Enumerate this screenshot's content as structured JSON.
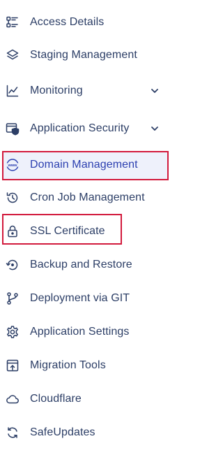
{
  "sidebar": {
    "items": [
      {
        "label": "Access Details",
        "icon": "access-details-icon"
      },
      {
        "label": "Staging Management",
        "icon": "staging-layers-icon"
      },
      {
        "label": "Monitoring",
        "icon": "monitoring-chart-icon",
        "expandable": true
      },
      {
        "label": "Application Security",
        "icon": "app-security-icon",
        "expandable": true
      },
      {
        "label": "Domain Management",
        "icon": "www-globe-icon",
        "active": true
      },
      {
        "label": "Cron Job Management",
        "icon": "history-clock-icon"
      },
      {
        "label": "SSL Certificate",
        "icon": "lock-icon"
      },
      {
        "label": "Backup and Restore",
        "icon": "backup-restore-icon"
      },
      {
        "label": "Deployment via GIT",
        "icon": "git-branch-icon"
      },
      {
        "label": "Application Settings",
        "icon": "gear-icon"
      },
      {
        "label": "Migration Tools",
        "icon": "migration-icon"
      },
      {
        "label": "Cloudflare",
        "icon": "cloud-icon"
      },
      {
        "label": "SafeUpdates",
        "icon": "refresh-icon"
      }
    ]
  },
  "colors": {
    "text": "#2c3e66",
    "active_text": "#2b3fb0",
    "active_background": "#eef1fb",
    "highlight_border": "#d21a3c",
    "www_icon": "#2b3fb0"
  }
}
